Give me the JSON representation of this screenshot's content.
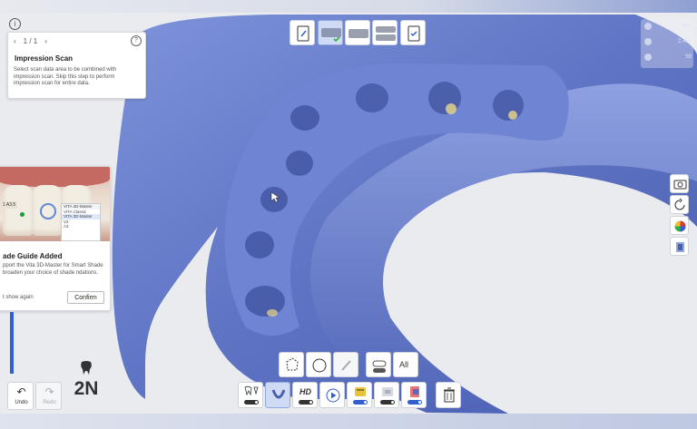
{
  "colors": {
    "scan_blue": "#6a7fcc",
    "accent": "#2f5fd0",
    "panel_bg": "#ffffff"
  },
  "guide": {
    "page": "1 / 1",
    "prev_icon": "chevron-left-icon",
    "next_icon": "chevron-right-icon",
    "help": "?",
    "title": "Impression Scan",
    "description": "Select scan data area to be combined with impression scan. Skip this step to perform impression scan for entire data."
  },
  "shade_notice": {
    "image_tag": "1 A3.5",
    "dropdown_options": [
      "VITA 3D-Master",
      "VITA Classic",
      "VITA 3D-Master",
      "V2",
      "A3"
    ],
    "title": "ade Guide Added",
    "description": "pport the Vita 3D-Master for Smart Shade broaden your choice of shade ndations.",
    "dont_show": "t show again",
    "confirm": "Confirm"
  },
  "stats": {
    "time": "49s",
    "points": "2,461",
    "count": "59"
  },
  "actions": {
    "undo": "Undo",
    "redo": "Redo"
  },
  "brand": {
    "logo": "2N"
  },
  "bottom_tools": {
    "all_label": "All",
    "hd_label": "HD"
  },
  "progress": {
    "fraction": 0.55
  }
}
